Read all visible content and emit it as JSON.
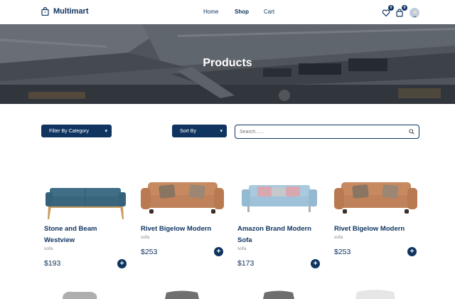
{
  "header": {
    "brand": "Multimart",
    "nav": [
      {
        "label": "Home",
        "active": false
      },
      {
        "label": "Shop",
        "active": true
      },
      {
        "label": "Cart",
        "active": false
      }
    ],
    "wishlist_count": "0",
    "cart_count": "0",
    "icons": [
      "shopping-bag-icon",
      "heart-icon",
      "cart-icon",
      "avatar"
    ]
  },
  "hero": {
    "title": "Products"
  },
  "filters": {
    "category_label": "Filter By Category",
    "sort_label": "Sort By",
    "search_placeholder": "Search......"
  },
  "products": [
    {
      "name": "Stone and Beam Westview",
      "category": "sofa",
      "price": "$193"
    },
    {
      "name": "Rivet Bigelow Modern",
      "category": "sofa",
      "price": "$253"
    },
    {
      "name": "Amazon Brand Modern Sofa",
      "category": "sofa",
      "price": "$173"
    },
    {
      "name": "Rivet Bigelow Modern",
      "category": "sofa",
      "price": "$253"
    }
  ],
  "colors": {
    "primary": "#0f3460",
    "muted": "#888888",
    "sofa_blue": "#3f6e86",
    "sofa_tan": "#c78a60",
    "sofa_light_blue": "#9fc2da"
  }
}
